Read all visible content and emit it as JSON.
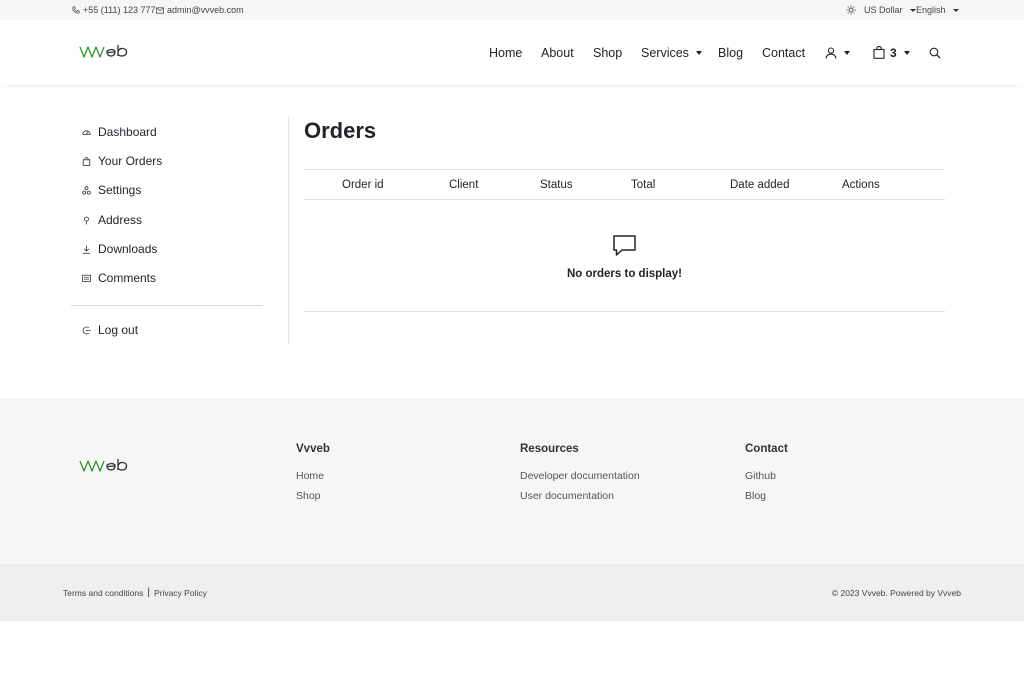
{
  "topbar": {
    "phone": "+55 (111) 123 777",
    "email": "admin@vvveb.com",
    "currency": "US Dollar",
    "language": "English"
  },
  "header": {
    "nav": [
      {
        "label": "Home"
      },
      {
        "label": "About"
      },
      {
        "label": "Shop"
      },
      {
        "label": "Services"
      },
      {
        "label": "Blog"
      },
      {
        "label": "Contact"
      }
    ],
    "cart_count": "3",
    "brand_color": "#3a9c3a"
  },
  "sidebar": {
    "items": [
      {
        "label": "Dashboard",
        "icon": "dashboard-icon"
      },
      {
        "label": "Your Orders",
        "icon": "bag-icon"
      },
      {
        "label": "Settings",
        "icon": "settings-icon"
      },
      {
        "label": "Address",
        "icon": "location-pin-icon"
      },
      {
        "label": "Downloads",
        "icon": "download-icon"
      },
      {
        "label": "Comments",
        "icon": "comment-icon"
      }
    ],
    "logout": "Log out"
  },
  "main": {
    "title": "Orders",
    "columns": [
      "Order id",
      "Client",
      "Status",
      "Total",
      "Date added",
      "Actions"
    ],
    "empty_message": "No orders to display!"
  },
  "footer": {
    "columns": [
      {
        "heading": "Vvveb",
        "links": [
          "Home",
          "Shop"
        ]
      },
      {
        "heading": "Resources",
        "links": [
          "Developer documentation",
          "User documentation"
        ]
      },
      {
        "heading": "Contact",
        "links": [
          "Github",
          "Blog"
        ]
      }
    ],
    "terms": "Terms and conditions",
    "separator": "|",
    "privacy": "Privacy Policy",
    "copyright": "© 2023 Vvveb. Powered by Vvveb"
  }
}
